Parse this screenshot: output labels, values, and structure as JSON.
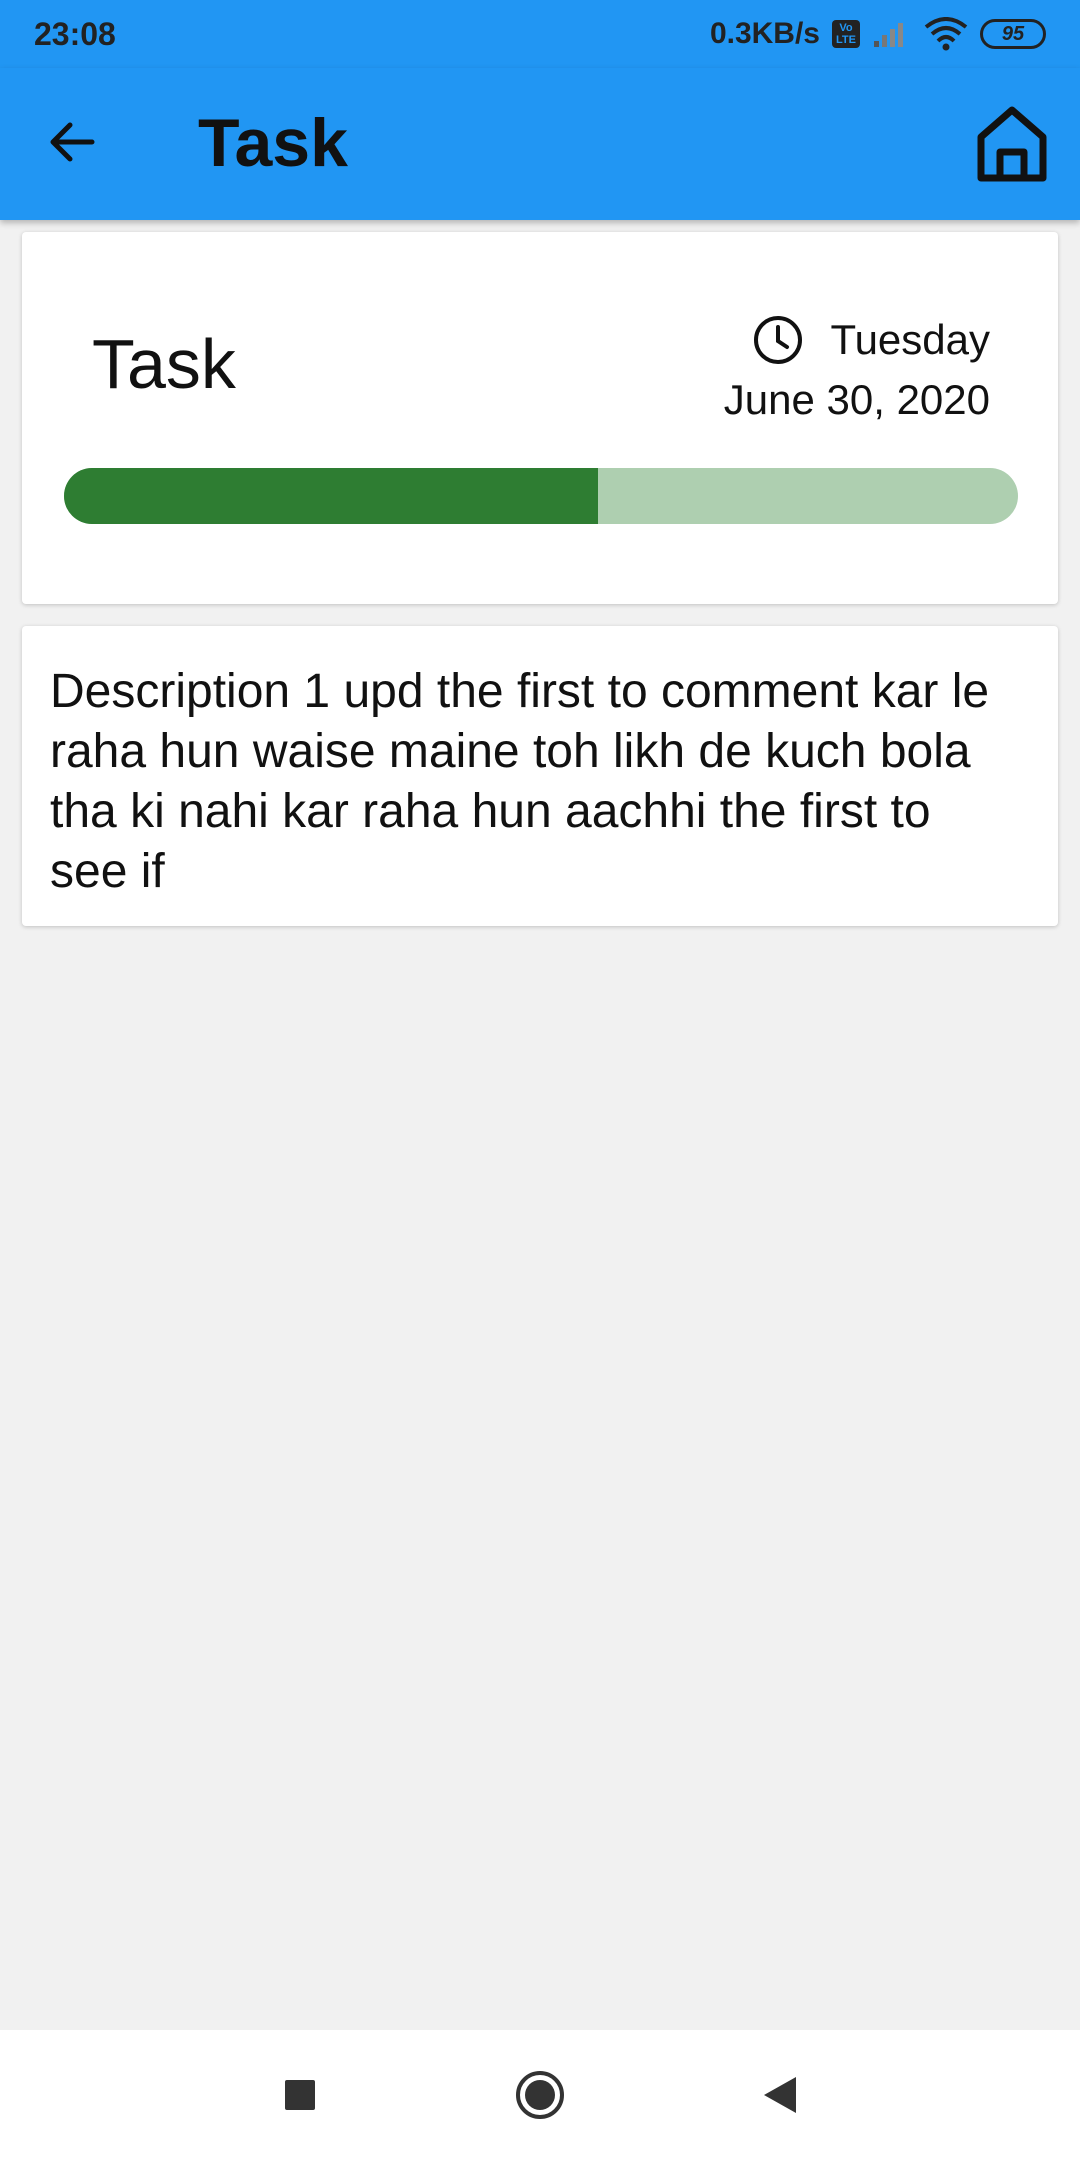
{
  "status_bar": {
    "time": "23:08",
    "net_speed": "0.3KB/s",
    "volte": "Vo LTE",
    "battery": "95"
  },
  "app_bar": {
    "title": "Task",
    "back_icon": "arrow-back-icon",
    "home_icon": "home-icon"
  },
  "task_card": {
    "name": "Task",
    "day": "Tuesday",
    "date": "June 30, 2020",
    "progress_fraction": 0.56
  },
  "description_card": {
    "text": "Description 1 upd the first to comment kar le raha hun waise maine toh likh de kuch bola tha ki nahi kar raha hun aachhi the first to see if"
  },
  "colors": {
    "primary": "#2196f3",
    "progress_fill": "#2e7d32",
    "progress_track": "#aecfb0",
    "background": "#f1f1f1"
  },
  "nav_bar": {
    "icons": [
      "recents-square-icon",
      "home-circle-icon",
      "back-triangle-icon"
    ]
  }
}
